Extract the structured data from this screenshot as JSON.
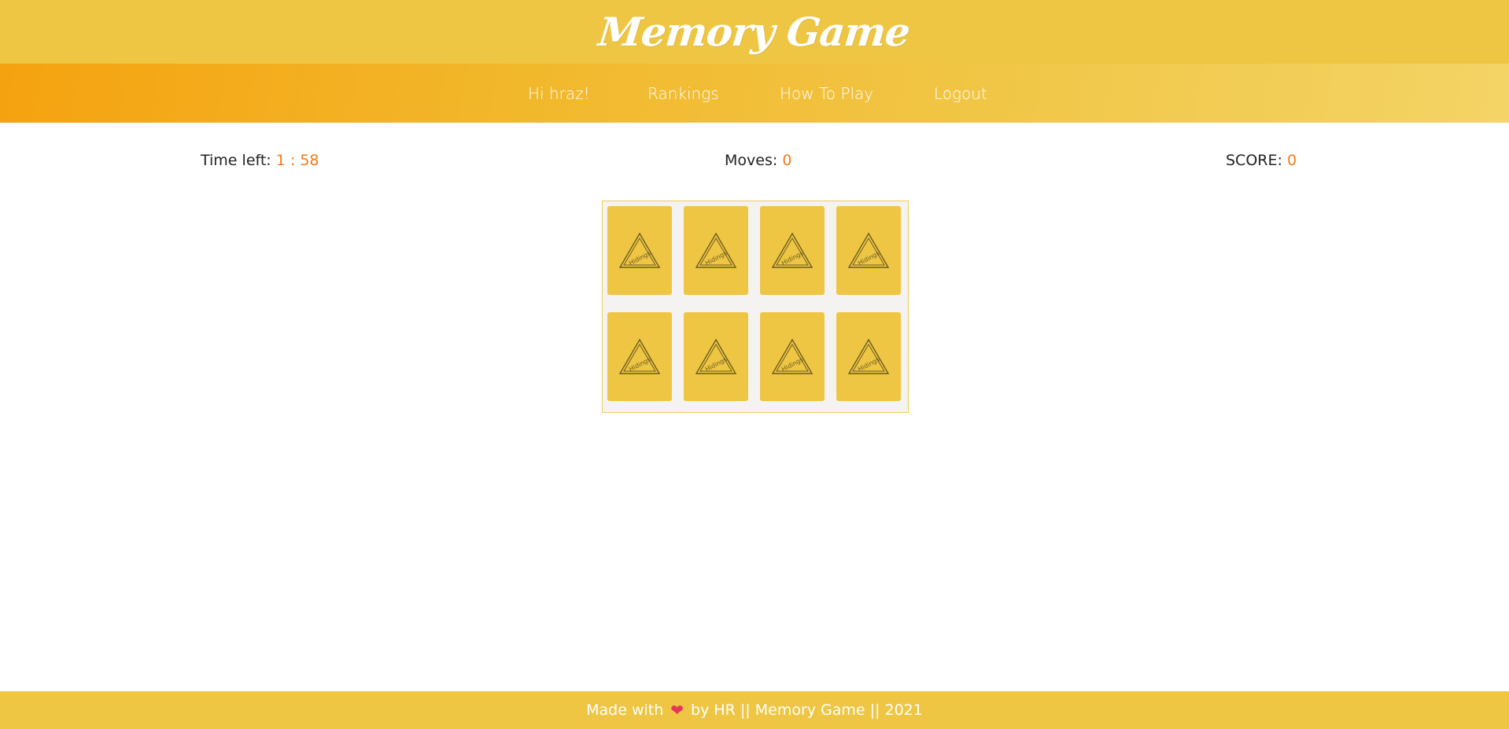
{
  "header": {
    "title": "Memory Game"
  },
  "nav": {
    "items": [
      {
        "label": "Hi hraz!"
      },
      {
        "label": "Rankings"
      },
      {
        "label": "How To Play"
      },
      {
        "label": "Logout"
      }
    ]
  },
  "stats": {
    "time_label": "Time left:",
    "time_value": "1 : 58",
    "moves_label": "Moves:",
    "moves_value": "0",
    "score_label": "SCORE:",
    "score_value": "0"
  },
  "board": {
    "rows": 2,
    "cols": 4,
    "card_back_label": "Hidings"
  },
  "footer": {
    "made_with": "Made with",
    "heart_icon": "heart-icon",
    "by_text": "by HR || Memory Game || 2021"
  },
  "colors": {
    "brand_yellow": "#eec644",
    "accent_orange": "#f07c1a",
    "heart": "#e8345a"
  }
}
